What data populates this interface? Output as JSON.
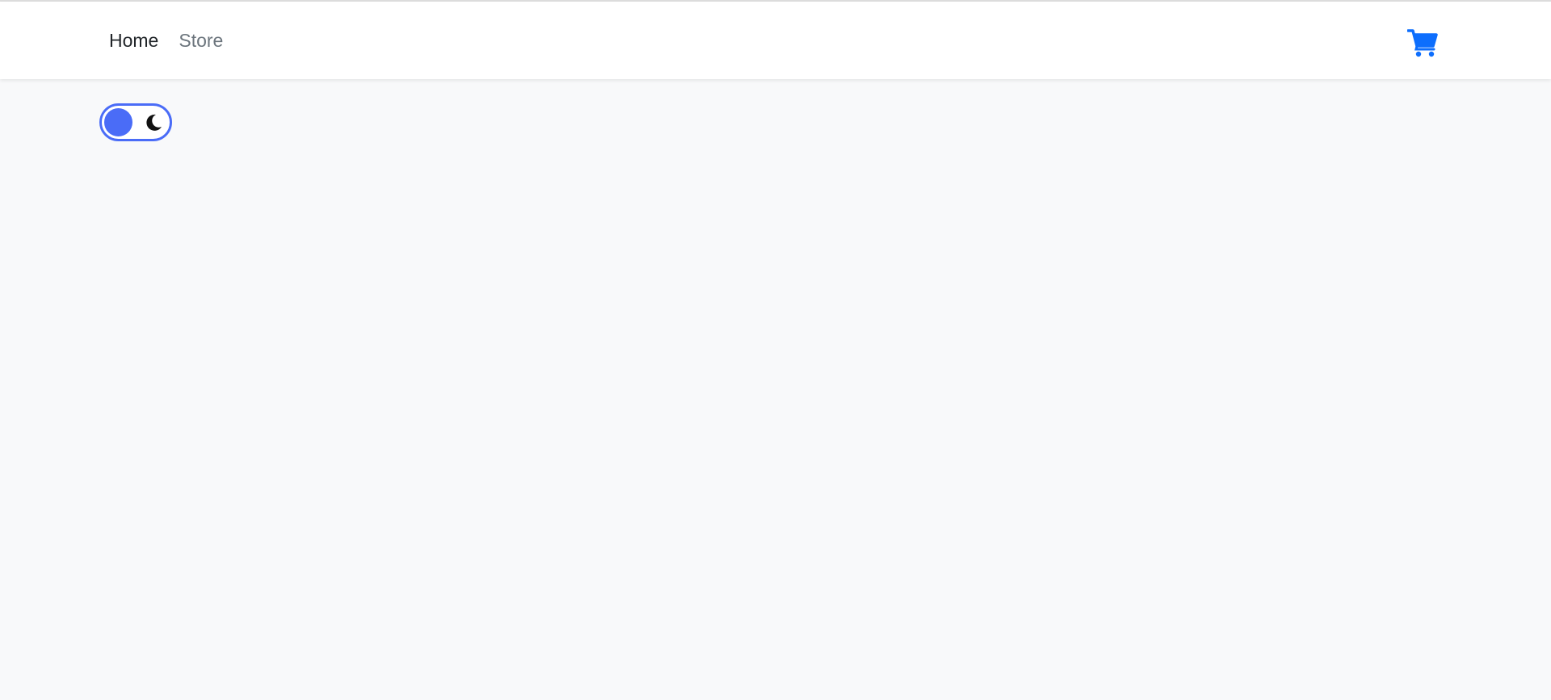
{
  "navbar": {
    "links": [
      {
        "label": "Home",
        "active": true
      },
      {
        "label": "Store",
        "active": false
      }
    ],
    "cart": {
      "icon": "shopping-cart-icon",
      "color": "#0d6efd"
    }
  },
  "theme_toggle": {
    "state": "light",
    "knob_color": "#4a6cf7",
    "icon": "moon-icon"
  },
  "colors": {
    "background": "#f8f9fa",
    "navbar_background": "#ffffff",
    "accent": "#0d6efd"
  }
}
